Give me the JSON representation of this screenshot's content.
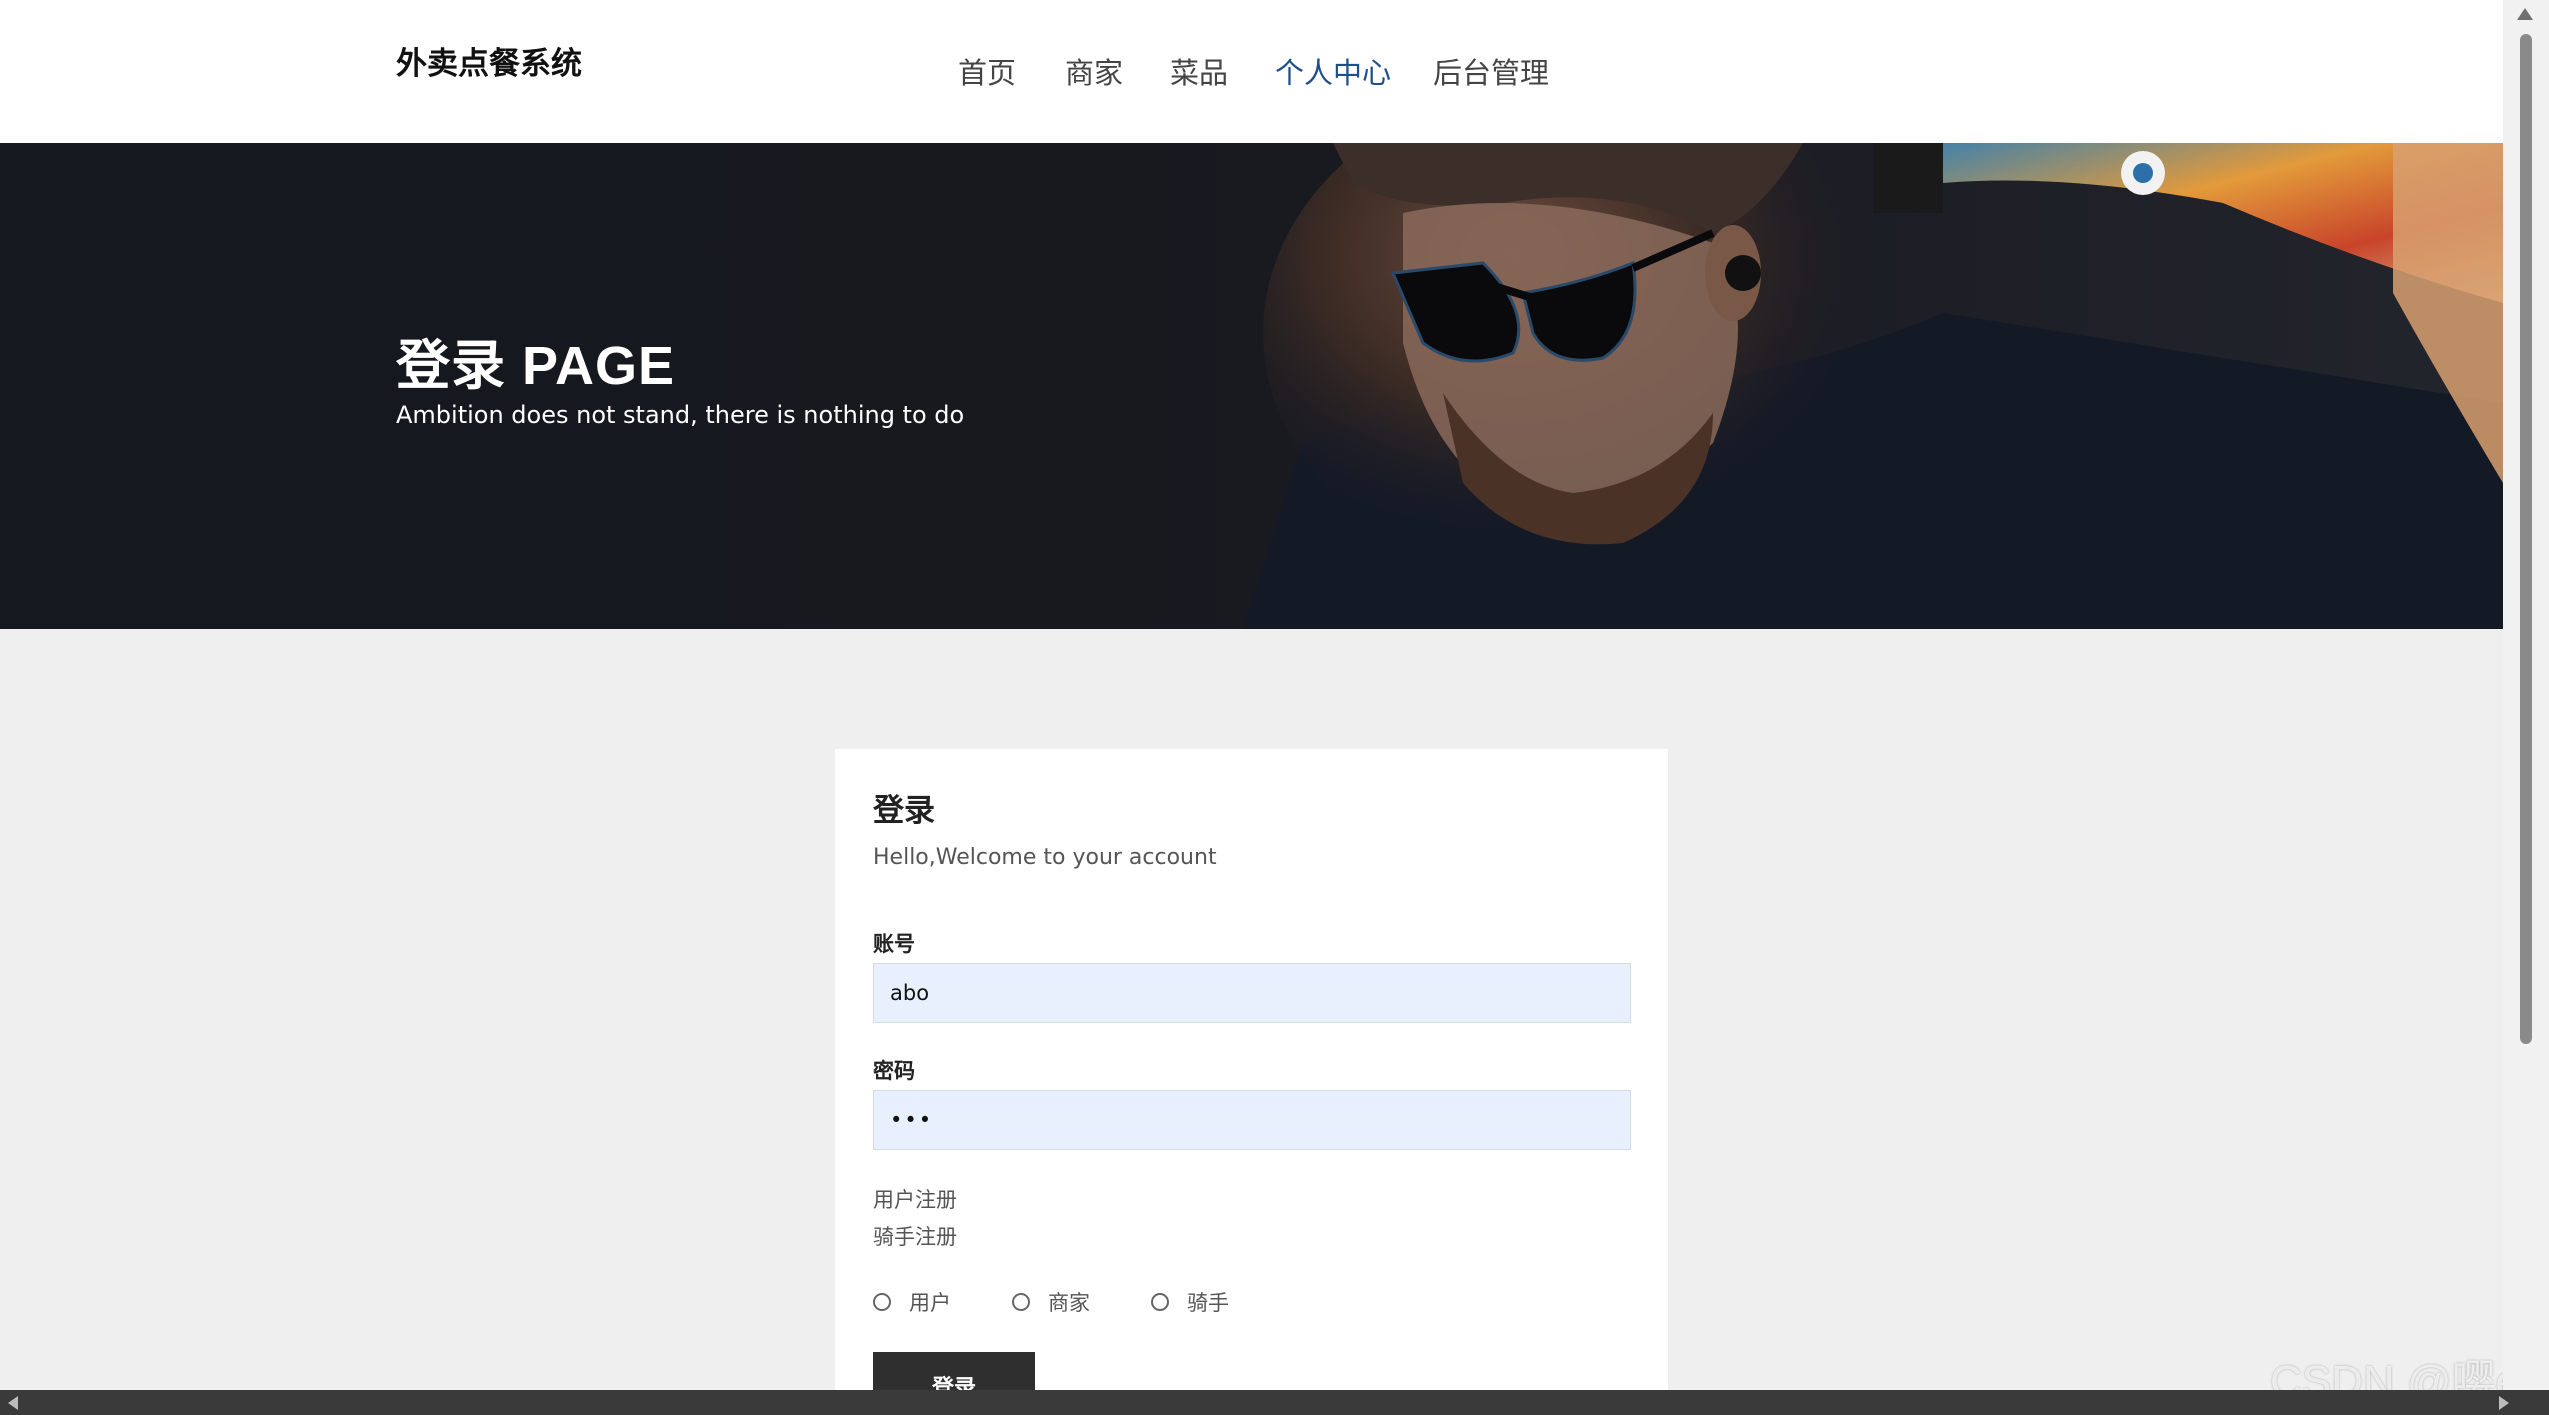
{
  "header": {
    "brand": "外卖点餐系统",
    "nav": [
      {
        "label": "首页"
      },
      {
        "label": "商家"
      },
      {
        "label": "菜品"
      },
      {
        "label": "个人中心"
      },
      {
        "label": "后台管理"
      }
    ],
    "active_color": "#1f4e8c"
  },
  "hero": {
    "title": "登录 PAGE",
    "subtitle": "Ambition does not stand, there is nothing to do"
  },
  "login": {
    "title": "登录",
    "subtitle": "Hello,Welcome to your account",
    "account_label": "账号",
    "account_value": "abo",
    "password_label": "密码",
    "password_value": "•••",
    "links": [
      "用户注册",
      "骑手注册"
    ],
    "roles": [
      {
        "label": "用户"
      },
      {
        "label": "商家"
      },
      {
        "label": "骑手"
      }
    ],
    "submit_label": "登录"
  },
  "watermark": "CSDN @嘤er"
}
